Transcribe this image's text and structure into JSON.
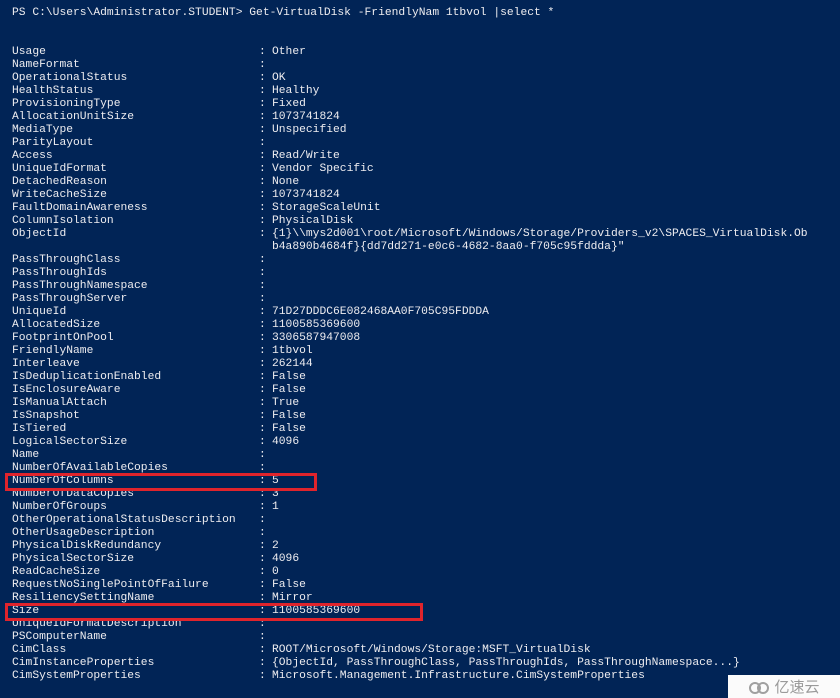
{
  "prompt": "PS C:\\Users\\Administrator.STUDENT> Get-VirtualDisk -FriendlyNam 1tbvol |select *",
  "properties": [
    {
      "key": "Usage",
      "value": "Other"
    },
    {
      "key": "NameFormat",
      "value": ""
    },
    {
      "key": "OperationalStatus",
      "value": "OK"
    },
    {
      "key": "HealthStatus",
      "value": "Healthy"
    },
    {
      "key": "ProvisioningType",
      "value": "Fixed"
    },
    {
      "key": "AllocationUnitSize",
      "value": "1073741824"
    },
    {
      "key": "MediaType",
      "value": "Unspecified"
    },
    {
      "key": "ParityLayout",
      "value": ""
    },
    {
      "key": "Access",
      "value": "Read/Write"
    },
    {
      "key": "UniqueIdFormat",
      "value": "Vendor Specific"
    },
    {
      "key": "DetachedReason",
      "value": "None"
    },
    {
      "key": "WriteCacheSize",
      "value": "1073741824"
    },
    {
      "key": "FaultDomainAwareness",
      "value": "StorageScaleUnit"
    },
    {
      "key": "ColumnIsolation",
      "value": "PhysicalDisk"
    },
    {
      "key": "ObjectId",
      "value": "{1}\\\\mys2d001\\root/Microsoft/Windows/Storage/Providers_v2\\SPACES_VirtualDisk.Ob",
      "value2": "b4a890b4684f}{dd7dd271-e0c6-4682-8aa0-f705c95fddda}\""
    },
    {
      "key": "PassThroughClass",
      "value": ""
    },
    {
      "key": "PassThroughIds",
      "value": ""
    },
    {
      "key": "PassThroughNamespace",
      "value": ""
    },
    {
      "key": "PassThroughServer",
      "value": ""
    },
    {
      "key": "UniqueId",
      "value": "71D27DDDC6E082468AA0F705C95FDDDA"
    },
    {
      "key": "AllocatedSize",
      "value": "1100585369600"
    },
    {
      "key": "FootprintOnPool",
      "value": "3306587947008"
    },
    {
      "key": "FriendlyName",
      "value": "1tbvol"
    },
    {
      "key": "Interleave",
      "value": "262144"
    },
    {
      "key": "IsDeduplicationEnabled",
      "value": "False"
    },
    {
      "key": "IsEnclosureAware",
      "value": "False"
    },
    {
      "key": "IsManualAttach",
      "value": "True"
    },
    {
      "key": "IsSnapshot",
      "value": "False"
    },
    {
      "key": "IsTiered",
      "value": "False"
    },
    {
      "key": "LogicalSectorSize",
      "value": "4096"
    },
    {
      "key": "Name",
      "value": ""
    },
    {
      "key": "NumberOfAvailableCopies",
      "value": ""
    },
    {
      "key": "NumberOfColumns",
      "value": "5",
      "highlight": true
    },
    {
      "key": "NumberOfDataCopies",
      "value": "3"
    },
    {
      "key": "NumberOfGroups",
      "value": "1"
    },
    {
      "key": "OtherOperationalStatusDescription",
      "value": ""
    },
    {
      "key": "OtherUsageDescription",
      "value": ""
    },
    {
      "key": "PhysicalDiskRedundancy",
      "value": "2"
    },
    {
      "key": "PhysicalSectorSize",
      "value": "4096"
    },
    {
      "key": "ReadCacheSize",
      "value": "0"
    },
    {
      "key": "RequestNoSinglePointOfFailure",
      "value": "False"
    },
    {
      "key": "ResiliencySettingName",
      "value": "Mirror"
    },
    {
      "key": "Size",
      "value": "1100585369600",
      "highlight": true
    },
    {
      "key": "UniqueIdFormatDescription",
      "value": ""
    },
    {
      "key": "PSComputerName",
      "value": ""
    },
    {
      "key": "CimClass",
      "value": "ROOT/Microsoft/Windows/Storage:MSFT_VirtualDisk"
    },
    {
      "key": "CimInstanceProperties",
      "value": "{ObjectId, PassThroughClass, PassThroughIds, PassThroughNamespace...}"
    },
    {
      "key": "CimSystemProperties",
      "value": "Microsoft.Management.Infrastructure.CimSystemProperties"
    }
  ],
  "colors": {
    "background": "#012456",
    "text": "#eeedf0",
    "highlight": "#e0242c"
  },
  "watermark": {
    "text": "亿速云",
    "icon": "cloud-logo-icon"
  }
}
